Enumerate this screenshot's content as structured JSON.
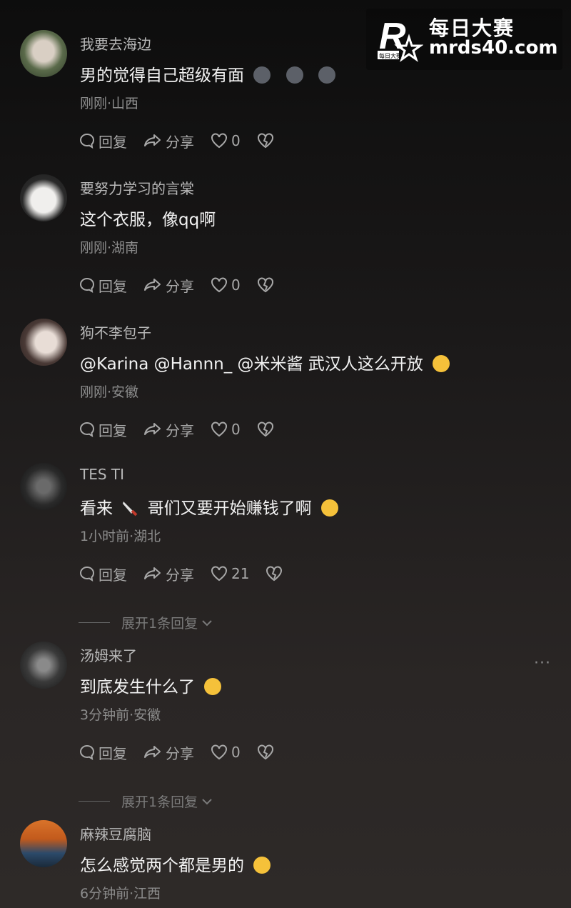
{
  "watermark": {
    "line1": "每日大赛",
    "line2": "mrds40.com",
    "logo_letter": "R",
    "logo_sub": "每日大赛"
  },
  "actions": {
    "reply": "回复",
    "share": "分享"
  },
  "comments": [
    {
      "username": "我要去海边",
      "text": "男的觉得自己超级有面",
      "emoji": "neutral-face-icon",
      "meta": "刚刚·山西",
      "likes": "0"
    },
    {
      "username": "要努力学习的言棠",
      "text": "这个衣服，像qq啊",
      "meta": "刚刚·湖南",
      "likes": "0"
    },
    {
      "username": "狗不李包子",
      "text": "@Karina  @Hannn_  @米米酱  武汉人这么开放",
      "emoji": "rofl-face-icon",
      "meta": "刚刚·安徽",
      "likes": "0"
    },
    {
      "username": "TES TI",
      "text_a": "看来",
      "text_b": "哥们又要开始赚钱了啊",
      "emoji": "knife-icon",
      "emoji2": "grinning-sweat-icon",
      "meta": "1小时前·湖北",
      "likes": "21",
      "expand": "展开1条回复"
    },
    {
      "username": "汤姆来了",
      "text": "到底发生什么了",
      "emoji": "yum-face-icon",
      "meta": "3分钟前·安徽",
      "likes": "0",
      "expand": "展开1条回复",
      "more": "···"
    },
    {
      "username": "麻辣豆腐脑",
      "text": "怎么感觉两个都是男的",
      "emoji": "crying-face-icon",
      "meta": "6分钟前·江西"
    }
  ]
}
